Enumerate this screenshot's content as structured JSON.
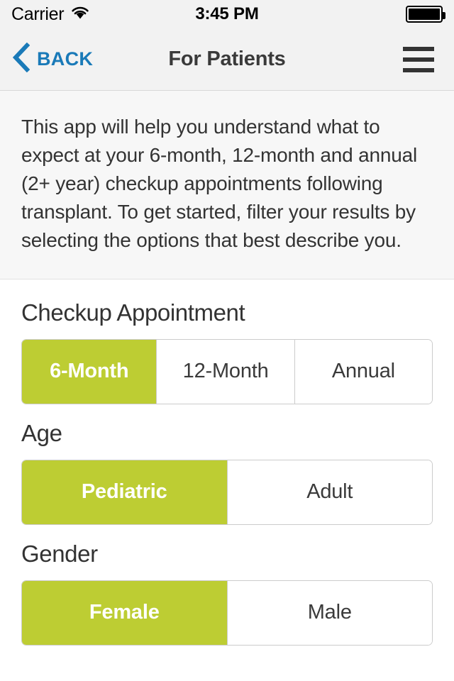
{
  "status_bar": {
    "carrier": "Carrier",
    "wifi_icon": "wifi-icon",
    "time": "3:45 PM",
    "battery_icon": "battery-full-icon",
    "battery_level_percent": 100
  },
  "nav_bar": {
    "back_icon": "chevron-left-icon",
    "back_label": "BACK",
    "title": "For Patients",
    "menu_icon": "hamburger-menu-icon",
    "back_color": "#1a7ab8",
    "title_color": "#3a3a3a"
  },
  "intro": {
    "text": "This app will help you understand what to expect at your 6-month, 12-month and annual (2+ year) checkup appointments following transplant. To get started, filter your results by selecting the options that best describe you."
  },
  "theme": {
    "accent_green": "#bdcd33",
    "link_blue": "#1a7ab8",
    "border_gray": "#cccccc",
    "panel_gray": "#f7f7f7"
  },
  "filters": [
    {
      "title": "Checkup Appointment",
      "options": [
        {
          "label": "6-Month",
          "selected": true,
          "flex": 1.0
        },
        {
          "label": "12-Month",
          "selected": false,
          "flex": 1.02
        },
        {
          "label": "Annual",
          "selected": false,
          "flex": 1.02
        }
      ]
    },
    {
      "title": "Age",
      "options": [
        {
          "label": "Pediatric",
          "selected": true,
          "flex": 1.0
        },
        {
          "label": "Adult",
          "selected": false,
          "flex": 1.0
        }
      ]
    },
    {
      "title": "Gender",
      "options": [
        {
          "label": "Female",
          "selected": true,
          "flex": 1.0
        },
        {
          "label": "Male",
          "selected": false,
          "flex": 1.0
        }
      ]
    }
  ]
}
